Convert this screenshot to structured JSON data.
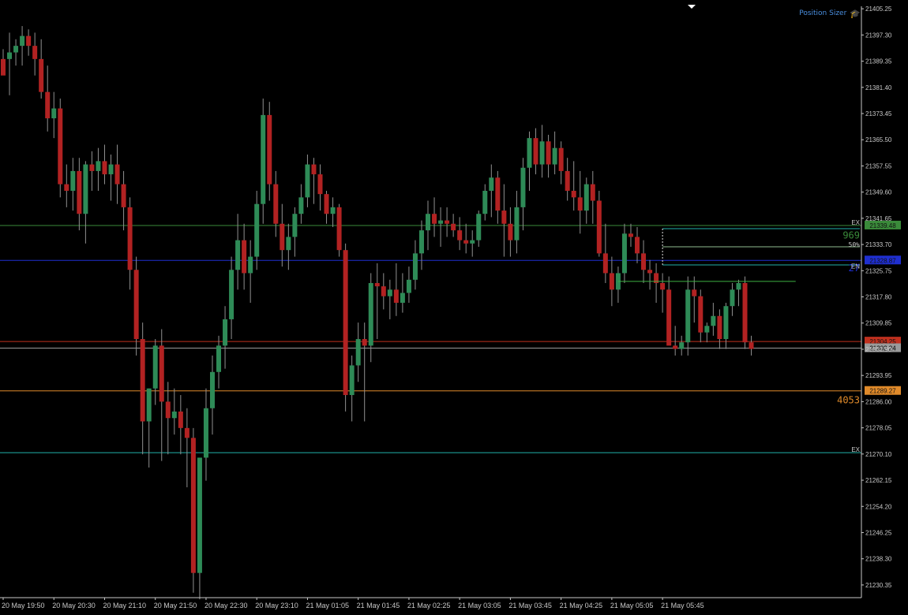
{
  "widget": {
    "label": "Position Sizer",
    "icon": "graduation-cap-icon"
  },
  "colors": {
    "background": "#000000",
    "axis": "#c8c8c8",
    "bull": "#2e8b57",
    "bear": "#b22222",
    "wick": "#909090",
    "exit_line": "#3a8a3a",
    "entry_line": "#1f2fd0",
    "stop_line": "#c0301e",
    "bid_line": "#9a9a9a",
    "tp_line": "#e08a2a",
    "lower_exit_line": "#20b2aa"
  },
  "chart_data": {
    "type": "candlestick",
    "ylim": [
      21226.5,
      21406
    ],
    "y_ticks": [
      "21405.25",
      "21397.30",
      "21389.35",
      "21381.40",
      "21373.45",
      "21365.50",
      "21357.55",
      "21349.60",
      "21341.65",
      "21333.70",
      "21325.75",
      "21317.80",
      "21309.85",
      "21301.90",
      "21293.95",
      "21286.00",
      "21278.05",
      "21270.10",
      "21262.15",
      "21254.20",
      "21246.25",
      "21238.30",
      "21230.35"
    ],
    "x_labels": [
      "20 May 19:50",
      "20 May 20:30",
      "20 May 21:10",
      "20 May 21:50",
      "20 May 22:30",
      "20 May 23:10",
      "21 May 01:05",
      "21 May 01:45",
      "21 May 02:25",
      "21 May 03:05",
      "21 May 03:45",
      "21 May 04:25",
      "21 May 05:05",
      "21 May 05:45"
    ],
    "labels_per_step": 8,
    "candles": [
      [
        21390,
        21393,
        21389,
        21385
      ],
      [
        21390,
        21398,
        21379,
        21392
      ],
      [
        21392,
        21396,
        21388,
        21394
      ],
      [
        21394,
        21400,
        21388,
        21397
      ],
      [
        21397,
        21399,
        21391,
        21394
      ],
      [
        21394,
        21398,
        21385,
        21390
      ],
      [
        21390,
        21396,
        21378,
        21380
      ],
      [
        21380,
        21388,
        21368,
        21372
      ],
      [
        21372,
        21380,
        21366,
        21375
      ],
      [
        21375,
        21378,
        21348,
        21352
      ],
      [
        21352,
        21358,
        21345,
        21350
      ],
      [
        21350,
        21360,
        21344,
        21356
      ],
      [
        21356,
        21360,
        21338,
        21343
      ],
      [
        21343,
        21359,
        21334,
        21358
      ],
      [
        21358,
        21362,
        21350,
        21356
      ],
      [
        21356,
        21363,
        21350,
        21359
      ],
      [
        21359,
        21364,
        21352,
        21355
      ],
      [
        21355,
        21361,
        21347,
        21358
      ],
      [
        21358,
        21364,
        21346,
        21352
      ],
      [
        21352,
        21356,
        21338,
        21345
      ],
      [
        21345,
        21348,
        21320,
        21326
      ],
      [
        21326,
        21330,
        21300,
        21305
      ],
      [
        21305,
        21310,
        21270,
        21280
      ],
      [
        21280,
        21290,
        21266,
        21290
      ],
      [
        21290,
        21305,
        21285,
        21303
      ],
      [
        21303,
        21308,
        21268,
        21286
      ],
      [
        21286,
        21292,
        21270,
        21281
      ],
      [
        21281,
        21290,
        21276,
        21283
      ],
      [
        21283,
        21288,
        21270,
        21278
      ],
      [
        21278,
        21284,
        21260,
        21275
      ],
      [
        21275,
        21278,
        21228,
        21234
      ],
      [
        21234,
        21262,
        21226,
        21269
      ],
      [
        21269,
        21290,
        21262,
        21284
      ],
      [
        21284,
        21300,
        21276,
        21295
      ],
      [
        21295,
        21306,
        21290,
        21303
      ],
      [
        21303,
        21315,
        21296,
        21311
      ],
      [
        21311,
        21330,
        21305,
        21326
      ],
      [
        21326,
        21343,
        21320,
        21335
      ],
      [
        21335,
        21340,
        21320,
        21325
      ],
      [
        21325,
        21335,
        21316,
        21330
      ],
      [
        21330,
        21350,
        21326,
        21346
      ],
      [
        21346,
        21378,
        21340,
        21373
      ],
      [
        21373,
        21377,
        21347,
        21352
      ],
      [
        21352,
        21356,
        21336,
        21340
      ],
      [
        21340,
        21346,
        21327,
        21332
      ],
      [
        21332,
        21340,
        21326,
        21336
      ],
      [
        21336,
        21345,
        21330,
        21343
      ],
      [
        21343,
        21352,
        21340,
        21348
      ],
      [
        21348,
        21361,
        21345,
        21358
      ],
      [
        21358,
        21360,
        21346,
        21355
      ],
      [
        21355,
        21358,
        21344,
        21349
      ],
      [
        21349,
        21350,
        21340,
        21343
      ],
      [
        21343,
        21348,
        21339,
        21345
      ],
      [
        21345,
        21346,
        21330,
        21332
      ],
      [
        21332,
        21334,
        21283,
        21288
      ],
      [
        21288,
        21300,
        21280,
        21297
      ],
      [
        21297,
        21310,
        21292,
        21305
      ],
      [
        21305,
        21310,
        21280,
        21303
      ],
      [
        21303,
        21325,
        21298,
        21322
      ],
      [
        21322,
        21328,
        21305,
        21321
      ],
      [
        21321,
        21325,
        21314,
        21318
      ],
      [
        21318,
        21323,
        21311,
        21320
      ],
      [
        21320,
        21328,
        21312,
        21316
      ],
      [
        21316,
        21325,
        21313,
        21319
      ],
      [
        21319,
        21327,
        21316,
        21323
      ],
      [
        21323,
        21335,
        21320,
        21331
      ],
      [
        21331,
        21341,
        21326,
        21338
      ],
      [
        21338,
        21347,
        21332,
        21343
      ],
      [
        21343,
        21348,
        21336,
        21340
      ],
      [
        21340,
        21345,
        21333,
        21341
      ],
      [
        21341,
        21345,
        21336,
        21340
      ],
      [
        21340,
        21343,
        21336,
        21338
      ],
      [
        21338,
        21342,
        21332,
        21335
      ],
      [
        21335,
        21340,
        21331,
        21334
      ],
      [
        21334,
        21338,
        21330,
        21335
      ],
      [
        21335,
        21344,
        21333,
        21343
      ],
      [
        21343,
        21352,
        21341,
        21350
      ],
      [
        21350,
        21358,
        21342,
        21354
      ],
      [
        21354,
        21356,
        21340,
        21344
      ],
      [
        21344,
        21352,
        21330,
        21340
      ],
      [
        21340,
        21345,
        21330,
        21335
      ],
      [
        21335,
        21350,
        21331,
        21345
      ],
      [
        21345,
        21360,
        21338,
        21357
      ],
      [
        21357,
        21368,
        21350,
        21366
      ],
      [
        21366,
        21369,
        21355,
        21358
      ],
      [
        21358,
        21370,
        21354,
        21365
      ],
      [
        21365,
        21367,
        21354,
        21358
      ],
      [
        21358,
        21368,
        21355,
        21363
      ],
      [
        21363,
        21365,
        21352,
        21356
      ],
      [
        21356,
        21360,
        21347,
        21350
      ],
      [
        21350,
        21359,
        21344,
        21348
      ],
      [
        21348,
        21356,
        21337,
        21344
      ],
      [
        21344,
        21354,
        21340,
        21352
      ],
      [
        21352,
        21356,
        21340,
        21347
      ],
      [
        21347,
        21350,
        21330,
        21331
      ],
      [
        21331,
        21340,
        21322,
        21325
      ],
      [
        21325,
        21330,
        21315,
        21320
      ],
      [
        21320,
        21327,
        21316,
        21325
      ],
      [
        21325,
        21340,
        21322,
        21337
      ],
      [
        21337,
        21340,
        21333,
        21336
      ],
      [
        21336,
        21339,
        21328,
        21331
      ],
      [
        21331,
        21335,
        21322,
        21326
      ],
      [
        21326,
        21329,
        21320,
        21325
      ],
      [
        21325,
        21328,
        21316,
        21322
      ],
      [
        21322,
        21325,
        21313,
        21320
      ],
      [
        21320,
        21324,
        21304,
        21303
      ],
      [
        21303,
        21309,
        21300,
        21302
      ],
      [
        21302,
        21306,
        21300,
        21304
      ],
      [
        21304,
        21324,
        21300,
        21320
      ],
      [
        21320,
        21324,
        21310,
        21318
      ],
      [
        21318,
        21320,
        21304,
        21307
      ],
      [
        21307,
        21310,
        21304,
        21309
      ],
      [
        21309,
        21316,
        21306,
        21312
      ],
      [
        21312,
        21314,
        21302,
        21305
      ],
      [
        21305,
        21316,
        21302,
        21315
      ],
      [
        21315,
        21322,
        21312,
        21320
      ],
      [
        21320,
        21323,
        21315,
        21322
      ],
      [
        21322,
        21324,
        21302,
        21304
      ],
      [
        21304,
        21306,
        21300,
        21302
      ]
    ],
    "levels": [
      {
        "kind": "exit",
        "price": 21339.48,
        "label": "21339.48",
        "marker": "EX",
        "color_key": "exit_line"
      },
      {
        "kind": "entry",
        "price": 21328.87,
        "label": "21328.87",
        "marker": "EN",
        "color_key": "entry_line"
      },
      {
        "kind": "stop",
        "price": 21304.25,
        "label": "21304.25",
        "color_key": "stop_line"
      },
      {
        "kind": "bid",
        "price": 21302.24,
        "label": "21302.24",
        "color_key": "bid_line"
      },
      {
        "kind": "take-profit",
        "price": 21289.27,
        "label": "21289.27",
        "color_key": "tp_line"
      },
      {
        "kind": "exit-lower",
        "price": 21270.5,
        "label": "",
        "marker": "EX",
        "color_key": "lower_exit_line"
      }
    ],
    "annotations": [
      {
        "text": "969",
        "price": 21336.5,
        "color_key": "exit_line"
      },
      {
        "text": "50%",
        "price": 21334.0,
        "color_key": "axis"
      },
      {
        "text": "27",
        "price": 21326.5,
        "color_key": "entry_line"
      },
      {
        "text": "4053",
        "price": 21286.5,
        "color_key": "tp_line"
      }
    ],
    "ps_box": {
      "start_candle": 104,
      "top": 21338.5,
      "mid": 21333.0,
      "bottom": 21327.5
    },
    "range_line": {
      "price": 21322.5,
      "start_candle": 97,
      "end_candle": 125
    }
  }
}
